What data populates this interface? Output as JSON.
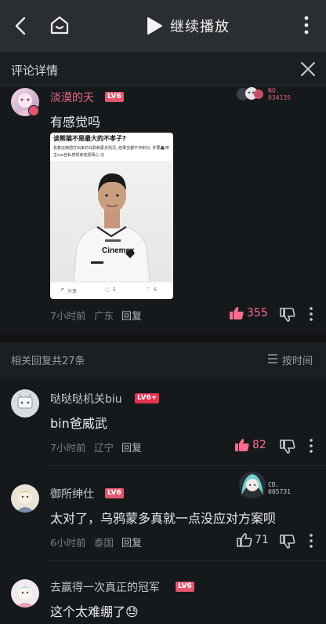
{
  "topbar": {
    "continue_label": "继续播放"
  },
  "detail": {
    "title": "评论详情"
  },
  "main_comment": {
    "username": "淡漠的天",
    "level": "LV6",
    "medal": {
      "name": "NU.",
      "number": "034135"
    },
    "text": "有感觉吗",
    "image": {
      "heading": "谈熊猫不是最大的不孝子?",
      "body": "看着这两把打出来的乌鸦和蒙多情况, 结果全都不作积对, 并要🎩神主cos自私表现家老愿网心 😊",
      "jersey_sponsor": "Cinemex",
      "actions": [
        "分享",
        "5",
        "6"
      ]
    },
    "time": "7小时前",
    "location": "广东",
    "reply_label": "回复",
    "likes": "355"
  },
  "related": {
    "count_label": "相关回复共27条",
    "sort_label": "按时间"
  },
  "replies": [
    {
      "username": "哒哒哒机关biu",
      "level": "LV6+",
      "text": "bin爸威武",
      "time": "7小时前",
      "location": "辽宁",
      "reply_label": "回复",
      "likes": "82"
    },
    {
      "username": "御所绅仕",
      "level": "LV6",
      "medal": {
        "name": "CD.",
        "number": "005731"
      },
      "text": "太对了，乌鸦蒙多真就一点没应对方案呗",
      "time": "6小时前",
      "location": "泰国",
      "reply_label": "回复",
      "likes": "71"
    },
    {
      "username": "去赢得一次真正的冠军",
      "level": "LV6",
      "text": "这个太难绷了😓"
    }
  ],
  "colors": {
    "accent_pink": "#e2576f",
    "like_active": "#ff6b8f",
    "background": "#16191c"
  }
}
